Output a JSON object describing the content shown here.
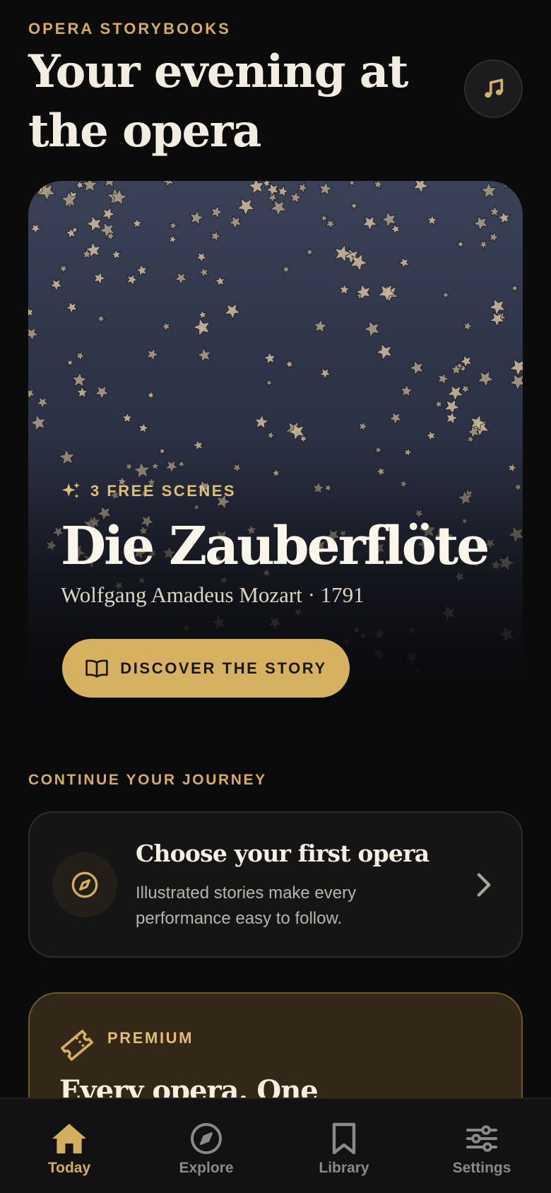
{
  "header": {
    "eyebrow": "OPERA STORYBOOKS",
    "title": "Your evening at the opera",
    "music_icon": "music-note-icon"
  },
  "hero": {
    "badge": "3 FREE SCENES",
    "badge_icon": "sparkles-icon",
    "title": "Die Zauberflöte",
    "subtitle": "Wolfgang Amadeus Mozart · 1791",
    "cta_label": "DISCOVER THE STORY",
    "cta_icon": "open-book-icon",
    "background": "starry-night-illustration"
  },
  "continue_section": {
    "label": "CONTINUE YOUR JOURNEY",
    "card": {
      "icon": "compass-icon",
      "title": "Choose your first opera",
      "description": "Illustrated stories make every performance easy to follow.",
      "chevron_icon": "chevron-right-icon"
    }
  },
  "premium": {
    "icon": "ticket-icon",
    "label": "PREMIUM",
    "title": "Every opera. One"
  },
  "tabbar": {
    "items": [
      {
        "label": "Today",
        "icon": "home-icon",
        "active": true
      },
      {
        "label": "Explore",
        "icon": "compass-icon",
        "active": false
      },
      {
        "label": "Library",
        "icon": "bookmark-icon",
        "active": false
      },
      {
        "label": "Settings",
        "icon": "sliders-icon",
        "active": false
      }
    ]
  },
  "colors": {
    "background": "#0b0b0c",
    "accent_gold": "#d4ad5f",
    "cta_gold": "#d6b260",
    "text_primary": "#f3ece0",
    "text_muted": "#b8b4ad",
    "premium_bg": "#332818"
  }
}
